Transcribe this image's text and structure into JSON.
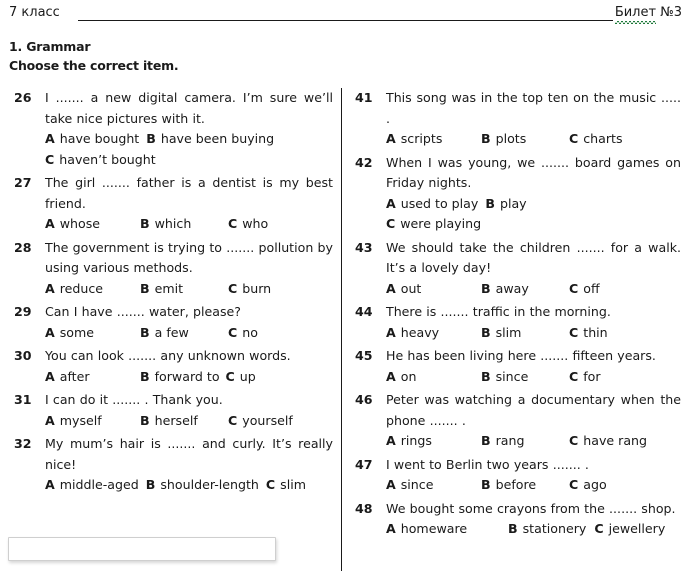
{
  "header": {
    "left_label": "7 класс",
    "right_label_spell": "Билет",
    "right_label_rest": " №3"
  },
  "section": {
    "title": "1. Grammar",
    "instruction": "Choose the correct item."
  },
  "answer_box": {
    "value": "",
    "placeholder": ""
  },
  "left_column": [
    {
      "number": "26",
      "text": "I ....... a new digital camera. I’m sure we’ll take nice pictures with it.",
      "layout": "split",
      "options_line1": [
        {
          "letter": "A",
          "text": "have bought"
        },
        {
          "letter": "B",
          "text": "have been buying"
        }
      ],
      "options_line2": [
        {
          "letter": "C",
          "text": "haven’t bought"
        }
      ]
    },
    {
      "number": "27",
      "text": "The girl ....... father is a dentist is my best friend.",
      "layout": "cols",
      "options": [
        {
          "letter": "A",
          "text": "whose"
        },
        {
          "letter": "B",
          "text": "which"
        },
        {
          "letter": "C",
          "text": "who"
        }
      ]
    },
    {
      "number": "28",
      "text": "The government is trying to ....... pollution by using various methods.",
      "layout": "cols",
      "options": [
        {
          "letter": "A",
          "text": "reduce"
        },
        {
          "letter": "B",
          "text": "emit"
        },
        {
          "letter": "C",
          "text": "burn"
        }
      ]
    },
    {
      "number": "29",
      "text": "Can I have ....... water, please?",
      "layout": "cols",
      "options": [
        {
          "letter": "A",
          "text": "some"
        },
        {
          "letter": "B",
          "text": "a few"
        },
        {
          "letter": "C",
          "text": "no"
        }
      ]
    },
    {
      "number": "30",
      "text": "You can look ....... any unknown words.",
      "layout": "cols-tight",
      "options": [
        {
          "letter": "A",
          "text": "after"
        },
        {
          "letter": "B",
          "text": "forward to"
        },
        {
          "letter": "C",
          "text": "up"
        }
      ]
    },
    {
      "number": "31",
      "text": "I can do it ....... . Thank you.",
      "layout": "cols",
      "options": [
        {
          "letter": "A",
          "text": "myself"
        },
        {
          "letter": "B",
          "text": "herself"
        },
        {
          "letter": "C",
          "text": "yourself"
        }
      ]
    },
    {
      "number": "32",
      "text": "My mum’s hair is ....... and curly. It’s really nice!",
      "layout": "flow",
      "options": [
        {
          "letter": "A",
          "text": "middle-aged"
        },
        {
          "letter": "B",
          "text": "shoulder-length"
        },
        {
          "letter": "C",
          "text": "slim"
        }
      ]
    }
  ],
  "right_column": [
    {
      "number": "41",
      "text": "This song was in the top ten on the music ..... .",
      "layout": "cols",
      "options": [
        {
          "letter": "A",
          "text": "scripts"
        },
        {
          "letter": "B",
          "text": "plots"
        },
        {
          "letter": "C",
          "text": "charts"
        }
      ]
    },
    {
      "number": "42",
      "text": "When I was young, we ....... board games on Friday nights.",
      "layout": "split",
      "options_line1": [
        {
          "letter": "A",
          "text": "used to play"
        },
        {
          "letter": "B",
          "text": "play"
        }
      ],
      "options_line2": [
        {
          "letter": "C",
          "text": "were playing"
        }
      ]
    },
    {
      "number": "43",
      "text": "We should take the children ....... for a walk. It’s a lovely day!",
      "layout": "cols",
      "options": [
        {
          "letter": "A",
          "text": "out"
        },
        {
          "letter": "B",
          "text": "away"
        },
        {
          "letter": "C",
          "text": "off"
        }
      ]
    },
    {
      "number": "44",
      "text": "There is ....... traffic in the morning.",
      "layout": "cols",
      "options": [
        {
          "letter": "A",
          "text": "heavy"
        },
        {
          "letter": "B",
          "text": "slim"
        },
        {
          "letter": "C",
          "text": "thin"
        }
      ]
    },
    {
      "number": "45",
      "text": "He has been living here ....... fifteen years.",
      "layout": "cols",
      "options": [
        {
          "letter": "A",
          "text": "on"
        },
        {
          "letter": "B",
          "text": "since"
        },
        {
          "letter": "C",
          "text": "for"
        }
      ]
    },
    {
      "number": "46",
      "text": "Peter was watching a documentary when the phone ....... .",
      "layout": "cols",
      "options": [
        {
          "letter": "A",
          "text": "rings"
        },
        {
          "letter": "B",
          "text": "rang"
        },
        {
          "letter": "C",
          "text": "have rang"
        }
      ]
    },
    {
      "number": "47",
      "text": "I went to Berlin two years ....... .",
      "layout": "cols",
      "options": [
        {
          "letter": "A",
          "text": "since"
        },
        {
          "letter": "B",
          "text": "before"
        },
        {
          "letter": "C",
          "text": "ago"
        }
      ]
    },
    {
      "number": "48",
      "text": "We bought some crayons from the ....... shop.",
      "layout": "wide",
      "options": [
        {
          "letter": "A",
          "text": "homeware"
        },
        {
          "letter": "B",
          "text": "stationery"
        },
        {
          "letter": "C",
          "text": "jewellery"
        }
      ]
    }
  ]
}
